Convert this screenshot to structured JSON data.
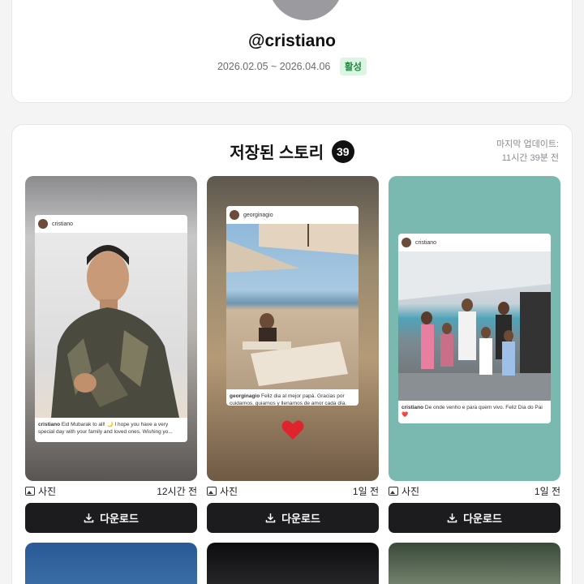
{
  "profile": {
    "handle": "@cristiano",
    "period": "2026.02.05 ~ 2026.04.06",
    "status": "활성"
  },
  "stories": {
    "title": "저장된 스토리",
    "count": "39",
    "last_update_label": "마지막 업데이트:",
    "last_update_value": "11시간 39분 전",
    "download_label": "다운로드",
    "items": [
      {
        "type_label": "사진",
        "age": "12시간 전",
        "post_user": "cristiano",
        "post_caption_user": "cristiano",
        "post_caption": "Eid Mubarak to all! 🌙 I hope you have a very special day with your family and loved ones. Wishing yo..."
      },
      {
        "type_label": "사진",
        "age": "1일 전",
        "post_user": "georginagio",
        "post_caption_user": "georginagio",
        "post_caption": "Feliz dia al mejor papá. Gracias por cuidarnos, guiarnos y llenarnos de amor cada día. Eres..."
      },
      {
        "type_label": "사진",
        "age": "1일 전",
        "post_user": "cristiano",
        "post_caption_user": "cristiano",
        "post_caption": "De onde venho e para quem vivo. Feliz Dia do Pai ❤️"
      }
    ]
  },
  "colors": {
    "badge_bg": "#dcf5e3",
    "badge_text": "#1a8a3c",
    "button_bg": "#1c1c1f",
    "heart": "#e0242e"
  }
}
